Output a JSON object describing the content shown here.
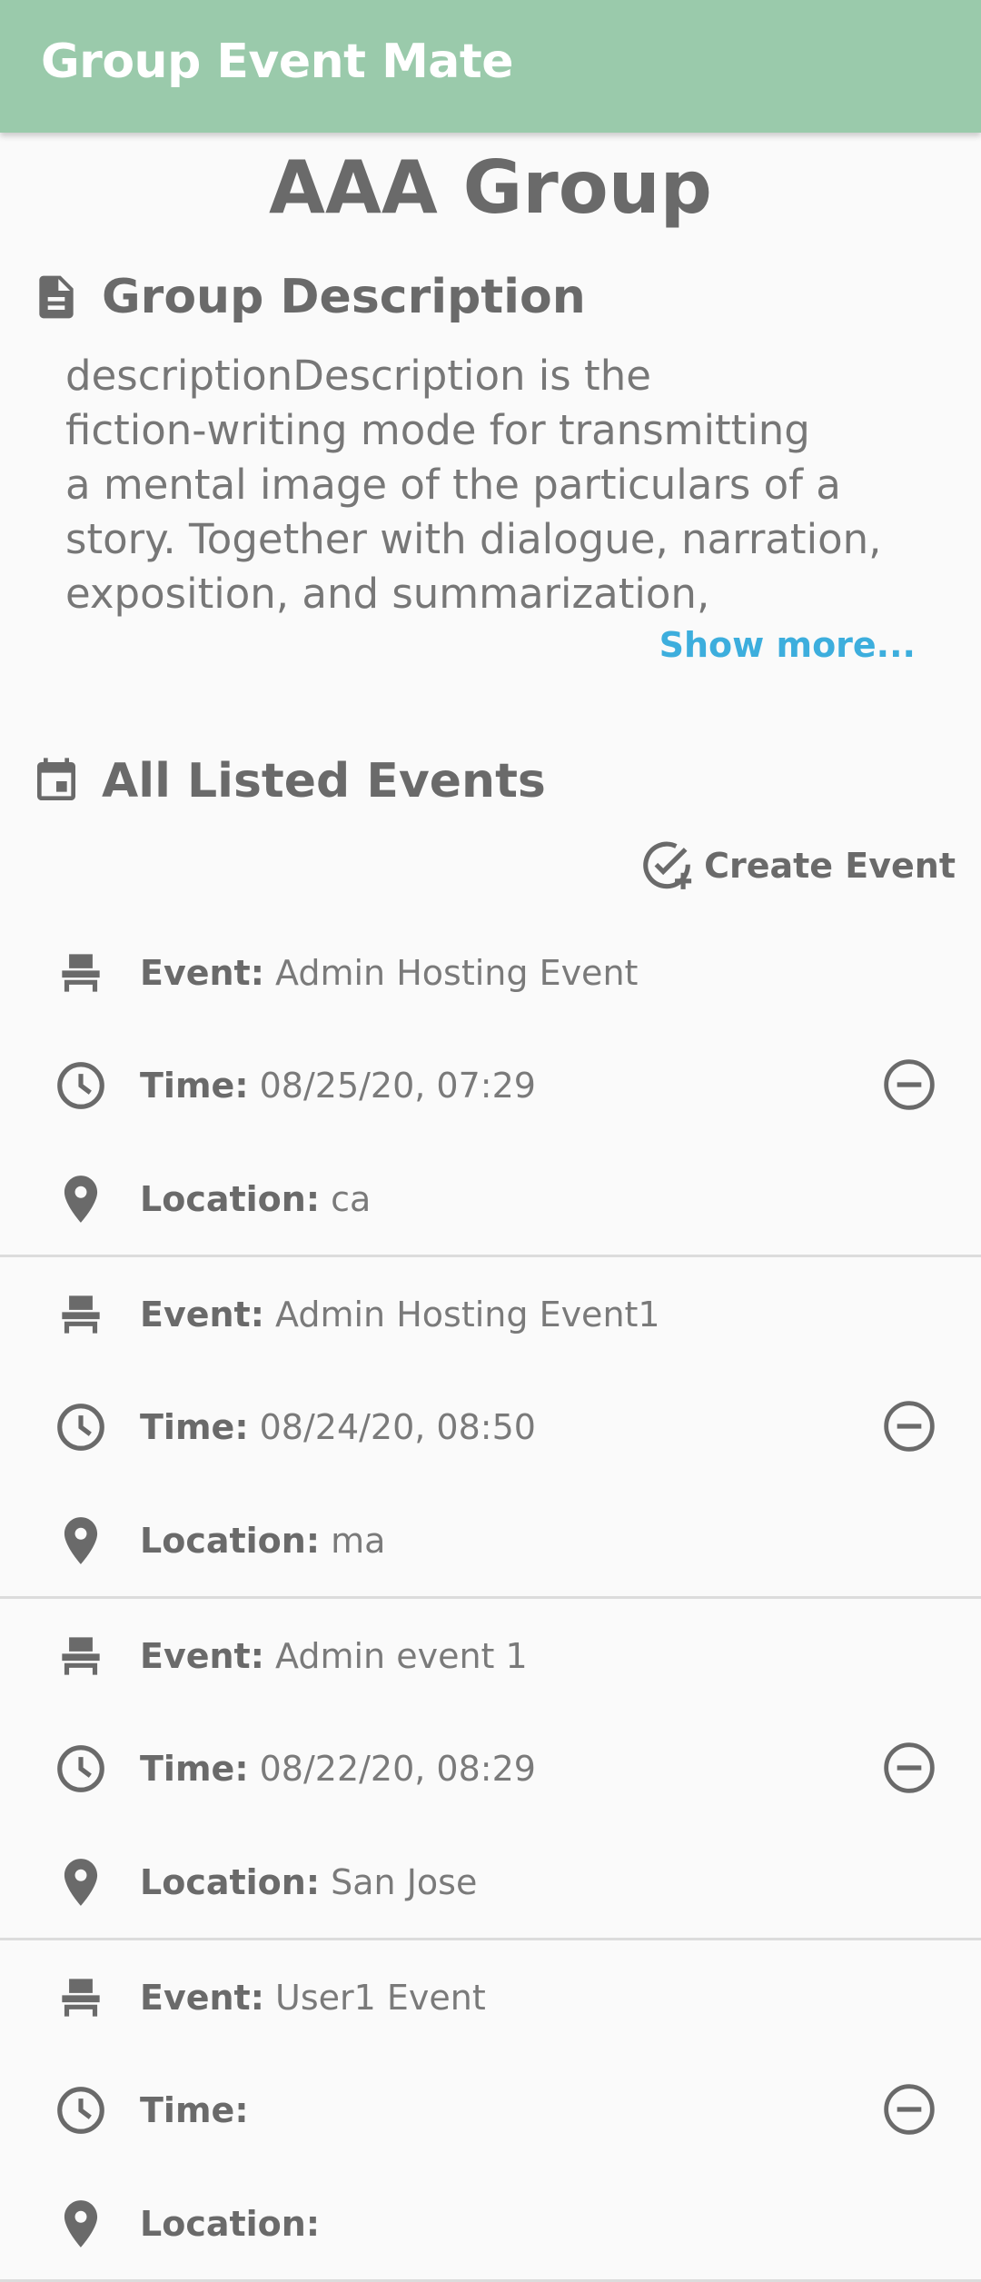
{
  "app_bar": {
    "title": "Group Event Mate",
    "color": "#9acaab"
  },
  "group": {
    "name": "AAA Group",
    "description_header": "Group Description",
    "description_lines": [
      "descriptionDescription is the",
      "fiction-writing mode for transmitting",
      "a mental image of the particulars of a",
      "story. Together with dialogue, narration,",
      "exposition, and summarization,"
    ],
    "show_more": "Show more..."
  },
  "events_section": {
    "header": "All Listed Events",
    "create_label": "Create Event",
    "event_label": "Event:",
    "time_label": "Time:",
    "location_label": "Location:",
    "events": [
      {
        "name": "Admin Hosting Event",
        "time": "08/25/20, 07:29",
        "location": "ca"
      },
      {
        "name": "Admin Hosting Event1",
        "time": "08/24/20, 08:50",
        "location": "ma"
      },
      {
        "name": "Admin event 1",
        "time": "08/22/20, 08:29",
        "location": "San Jose"
      },
      {
        "name": "User1 Event",
        "time": "",
        "location": ""
      }
    ]
  },
  "icons": {
    "description": "document-icon",
    "events": "calendar-icon",
    "create": "add-task-icon",
    "event": "seat-icon",
    "time": "clock-icon",
    "location": "location-pin-icon",
    "remove": "remove-circle-icon"
  },
  "colors": {
    "accent_link": "#3daedd",
    "text": "#6a6a6a"
  }
}
